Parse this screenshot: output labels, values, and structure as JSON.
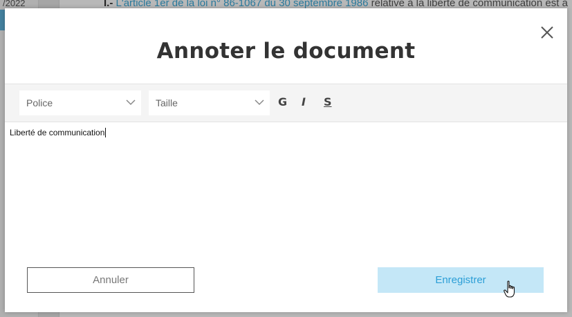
{
  "background": {
    "date_fragment": "/2022",
    "top_line": {
      "prefix": "I.-",
      "lead": " L'",
      "link_text": "article 1er de la loi n° 86-1067 du 30 septembre 1986",
      "rest": " relative à la liberté de communication est a"
    }
  },
  "modal": {
    "title": "Annoter le document",
    "close_icon": "close-icon",
    "toolbar": {
      "font_select": "Police",
      "size_select": "Taille",
      "bold_label": "G",
      "italic_label": "I",
      "strike_label": "S"
    },
    "editor": {
      "content": "Liberté de communication"
    },
    "buttons": {
      "cancel": "Annuler",
      "save": "Enregistrer"
    }
  },
  "colors": {
    "accent": "#2b9ed6",
    "save_bg": "#c4e7f7",
    "link": "#3ca9d8"
  }
}
